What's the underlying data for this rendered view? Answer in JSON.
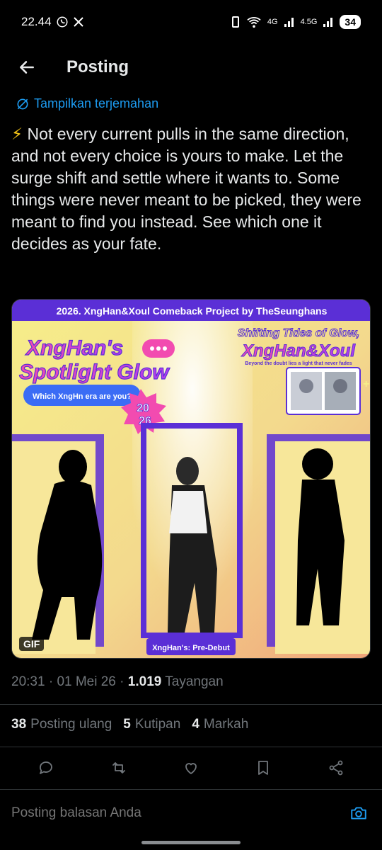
{
  "status_bar": {
    "time": "22.44",
    "network_a": "4G",
    "network_b": "4.5G",
    "battery": "34"
  },
  "header": {
    "title": "Posting"
  },
  "translate_label": "Tampilkan terjemahan",
  "post": {
    "emoji": "⚡",
    "text": " Not every current pulls in the same direction, and not every choice is yours to make. Let the surge shift and settle where it wants to. Some things were never meant to be picked, they were meant to find you instead. See which one it decides as your fate."
  },
  "media": {
    "banner": "2026. XngHan&Xoul Comeback Project by TheSeunghans",
    "headline_line1": "XngHan's",
    "headline_line2": "Spotlight Glow",
    "bubble": "Which XngHn era are you?",
    "year_top": "20",
    "year_bottom": "26",
    "tagline_small": "Shifting Tides of Glow,",
    "tagline_big": "XngHan&Xoul",
    "tagline_sub": "Beyond the doubt lies a light that never fades",
    "caption": "XngHan's: Pre-Debut",
    "gif_label": "GIF"
  },
  "meta": {
    "time": "20:31",
    "date": "01 Mei 26",
    "views": "1.019",
    "views_label": "Tayangan"
  },
  "stats": {
    "reposts": "38",
    "reposts_label": "Posting ulang",
    "quotes": "5",
    "quotes_label": "Kutipan",
    "bookmarks": "4",
    "bookmarks_label": "Markah"
  },
  "reply": {
    "placeholder": "Posting balasan Anda"
  },
  "colors": {
    "background": "#000000",
    "text": "#e7e9ea",
    "muted": "#71767b",
    "accent": "#1d9bf0",
    "divider": "#2f3336",
    "media_purple": "#5b2fd6",
    "media_yellow": "#f2e36b",
    "media_pink": "#e83aa8"
  },
  "icons": {
    "back": "arrow-left-icon",
    "translate": "translate-icon",
    "reply": "reply-icon",
    "repost": "repost-icon",
    "like": "heart-icon",
    "bookmark": "bookmark-icon",
    "share": "share-icon",
    "camera": "camera-icon"
  }
}
